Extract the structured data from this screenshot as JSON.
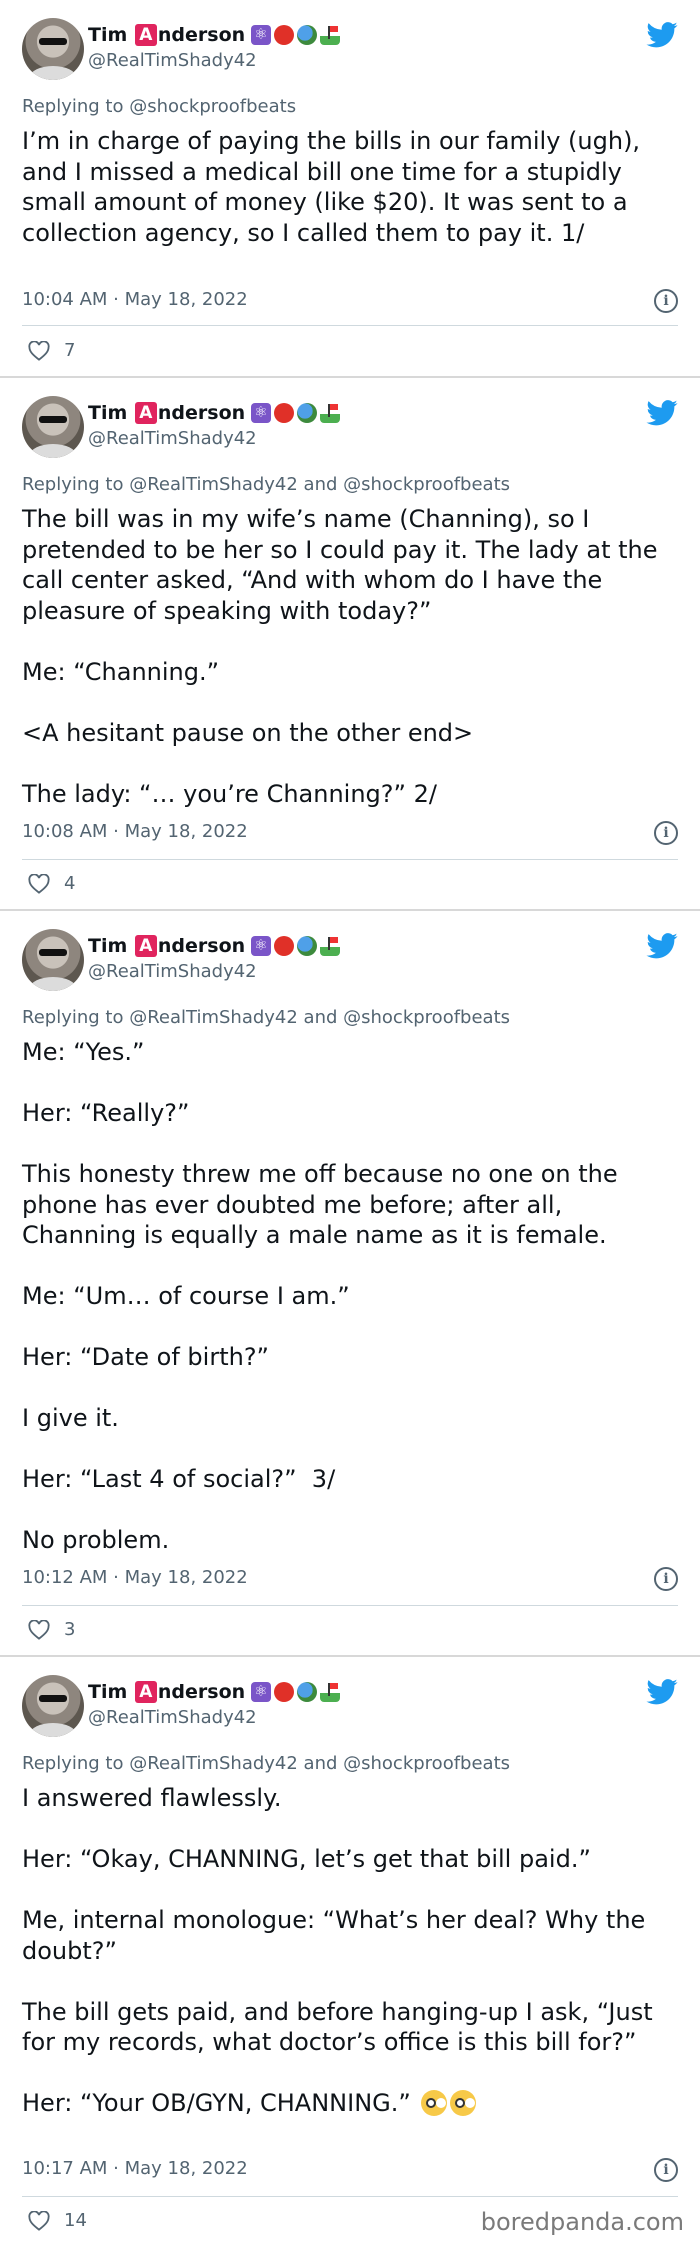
{
  "author": {
    "name_prefix": "Tim ",
    "name_letter": "A",
    "name_suffix": "nderson",
    "handle": "@RealTimShady42",
    "emoji_icons": [
      "atom-symbol-icon",
      "tomato-icon",
      "globe-icon",
      "golf-flag-icon"
    ]
  },
  "colors": {
    "twitter_blue": "#1d9bf0",
    "text": "#0f1419",
    "muted": "#536471",
    "name_letter_bg": "#e0245e"
  },
  "tweets": [
    {
      "replying": "Replying to @shockproofbeats",
      "paragraphs": [
        "I’m in charge of paying the bills in our family (ugh), and I missed a medical bill one time for a stupidly small amount of money (like $20). It was sent to a collection agency, so I called them to pay it. 1/"
      ],
      "timestamp": "10:04 AM · May 18, 2022",
      "likes": "7"
    },
    {
      "replying": "Replying to @RealTimShady42 and @shockproofbeats",
      "paragraphs": [
        "The bill was in my wife’s name (Channing), so I pretended to be her so I could pay it. The lady at the call center asked, “And with whom do I have the pleasure of speaking with today?”",
        "Me: “Channing.”",
        "<A hesitant pause on the other end>",
        "The lady: “… you’re Channing?” 2/"
      ],
      "timestamp": "10:08 AM · May 18, 2022",
      "likes": "4"
    },
    {
      "replying": "Replying to @RealTimShady42 and @shockproofbeats",
      "paragraphs": [
        "Me: “Yes.”",
        "Her: “Really?”",
        "This honesty threw me off because no one on the phone has ever doubted me before; after all, Channing is equally a male name as it is female.",
        "Me: “Um… of course I am.”",
        "Her: “Date of birth?”",
        "I give it.",
        "Her: “Last 4 of social?”  3/",
        "No problem."
      ],
      "timestamp": "10:12 AM · May 18, 2022",
      "likes": "3"
    },
    {
      "replying": "Replying to @RealTimShady42 and @shockproofbeats",
      "paragraphs": [
        "I answered flawlessly.",
        "Her: “Okay, CHANNING, let’s get that bill paid.”",
        "Me, internal monologue: “What’s her deal? Why the doubt?”",
        "The bill gets paid, and before hanging-up I ask, “Just for my records, what doctor’s office is this bill for?”",
        "Her: “Your OB/GYN, CHANNING.”"
      ],
      "trailing_emoji": "flushed-face-icon",
      "timestamp": "10:17 AM · May 18, 2022",
      "likes": "14"
    }
  ],
  "watermark": "boredpanda.com"
}
